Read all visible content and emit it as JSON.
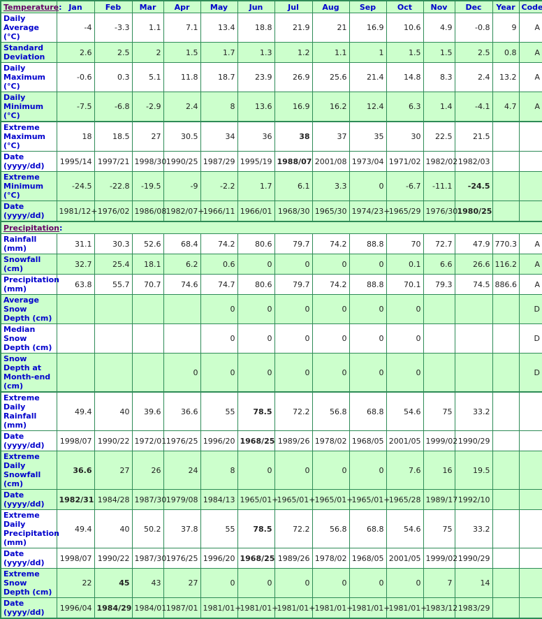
{
  "header": {
    "section_temperature": "Temperature",
    "colon": ":",
    "months": [
      "Jan",
      "Feb",
      "Mar",
      "Apr",
      "May",
      "Jun",
      "Jul",
      "Aug",
      "Sep",
      "Oct",
      "Nov",
      "Dec"
    ],
    "year": "Year",
    "code": "Code"
  },
  "temperature": {
    "daily_average": {
      "label": "Daily Average (°C)",
      "values": [
        "-4",
        "-3.3",
        "1.1",
        "7.1",
        "13.4",
        "18.8",
        "21.9",
        "21",
        "16.9",
        "10.6",
        "4.9",
        "-0.8"
      ],
      "year": "9",
      "code": "A"
    },
    "std_dev": {
      "label": "Standard Deviation",
      "values": [
        "2.6",
        "2.5",
        "2",
        "1.5",
        "1.7",
        "1.3",
        "1.2",
        "1.1",
        "1",
        "1.5",
        "1.5",
        "2.5"
      ],
      "year": "0.8",
      "code": "A"
    },
    "daily_max": {
      "label": "Daily Maximum (°C)",
      "values": [
        "-0.6",
        "0.3",
        "5.1",
        "11.8",
        "18.7",
        "23.9",
        "26.9",
        "25.6",
        "21.4",
        "14.8",
        "8.3",
        "2.4"
      ],
      "year": "13.2",
      "code": "A"
    },
    "daily_min": {
      "label": "Daily Minimum (°C)",
      "values": [
        "-7.5",
        "-6.8",
        "-2.9",
        "2.4",
        "8",
        "13.6",
        "16.9",
        "16.2",
        "12.4",
        "6.3",
        "1.4",
        "-4.1"
      ],
      "year": "4.7",
      "code": "A"
    },
    "extreme_max": {
      "label": "Extreme Maximum (°C)",
      "values": [
        "18",
        "18.5",
        "27",
        "30.5",
        "34",
        "36",
        "38",
        "37",
        "35",
        "30",
        "22.5",
        "21.5"
      ],
      "year": "",
      "code": ""
    },
    "extreme_max_date": {
      "label": "Date (yyyy/dd)",
      "values": [
        "1995/14",
        "1997/21",
        "1998/30",
        "1990/25",
        "1987/29",
        "1995/19",
        "1988/07",
        "2001/08",
        "1973/04",
        "1971/02",
        "1982/02",
        "1982/03"
      ],
      "year": "",
      "code": ""
    },
    "extreme_min": {
      "label": "Extreme Minimum (°C)",
      "values": [
        "-24.5",
        "-22.8",
        "-19.5",
        "-9",
        "-2.2",
        "1.7",
        "6.1",
        "3.3",
        "0",
        "-6.7",
        "-11.1",
        "-24.5"
      ],
      "year": "",
      "code": ""
    },
    "extreme_min_date": {
      "label": "Date (yyyy/dd)",
      "values": [
        "1981/12+",
        "1976/02",
        "1986/08",
        "1982/07+",
        "1966/11",
        "1966/01",
        "1968/30",
        "1965/30",
        "1974/23+",
        "1965/29",
        "1976/30",
        "1980/25"
      ],
      "year": "",
      "code": ""
    }
  },
  "precipitation": {
    "section_label": "Precipitation",
    "rainfall": {
      "label": "Rainfall (mm)",
      "values": [
        "31.1",
        "30.3",
        "52.6",
        "68.4",
        "74.2",
        "80.6",
        "79.7",
        "74.2",
        "88.8",
        "70",
        "72.7",
        "47.9"
      ],
      "year": "770.3",
      "code": "A"
    },
    "snowfall": {
      "label": "Snowfall (cm)",
      "values": [
        "32.7",
        "25.4",
        "18.1",
        "6.2",
        "0.6",
        "0",
        "0",
        "0",
        "0",
        "0.1",
        "6.6",
        "26.6"
      ],
      "year": "116.2",
      "code": "A"
    },
    "precip": {
      "label": "Precipitation (mm)",
      "values": [
        "63.8",
        "55.7",
        "70.7",
        "74.6",
        "74.7",
        "80.6",
        "79.7",
        "74.2",
        "88.8",
        "70.1",
        "79.3",
        "74.5"
      ],
      "year": "886.6",
      "code": "A"
    },
    "avg_snow_depth": {
      "label": "Average Snow Depth (cm)",
      "values": [
        "",
        "",
        "",
        "",
        "0",
        "0",
        "0",
        "0",
        "0",
        "0",
        "",
        ""
      ],
      "year": "",
      "code": "D"
    },
    "median_snow_depth": {
      "label": "Median Snow Depth (cm)",
      "values": [
        "",
        "",
        "",
        "",
        "0",
        "0",
        "0",
        "0",
        "0",
        "0",
        "",
        ""
      ],
      "year": "",
      "code": "D"
    },
    "snow_depth_month_end": {
      "label": "Snow Depth at Month-end (cm)",
      "values": [
        "",
        "",
        "",
        "0",
        "0",
        "0",
        "0",
        "0",
        "0",
        "0",
        "",
        ""
      ],
      "year": "",
      "code": "D"
    },
    "ext_daily_rain": {
      "label": "Extreme Daily Rainfall (mm)",
      "values": [
        "49.4",
        "40",
        "39.6",
        "36.6",
        "55",
        "78.5",
        "72.2",
        "56.8",
        "68.8",
        "54.6",
        "75",
        "33.2"
      ],
      "year": "",
      "code": ""
    },
    "ext_daily_rain_date": {
      "label": "Date (yyyy/dd)",
      "values": [
        "1998/07",
        "1990/22",
        "1972/01",
        "1976/25",
        "1996/20",
        "1968/25",
        "1989/26",
        "1978/02",
        "1968/05",
        "2001/05",
        "1999/02",
        "1990/29"
      ],
      "year": "",
      "code": ""
    },
    "ext_daily_snow": {
      "label": "Extreme Daily Snowfall (cm)",
      "values": [
        "36.6",
        "27",
        "26",
        "24",
        "8",
        "0",
        "0",
        "0",
        "0",
        "7.6",
        "16",
        "19.5"
      ],
      "year": "",
      "code": ""
    },
    "ext_daily_snow_date": {
      "label": "Date (yyyy/dd)",
      "values": [
        "1982/31",
        "1984/28",
        "1987/30",
        "1979/08",
        "1984/13",
        "1965/01+",
        "1965/01+",
        "1965/01+",
        "1965/01+",
        "1965/28",
        "1989/17",
        "1992/10"
      ],
      "year": "",
      "code": ""
    },
    "ext_daily_precip": {
      "label": "Extreme Daily Precipitation (mm)",
      "values": [
        "49.4",
        "40",
        "50.2",
        "37.8",
        "55",
        "78.5",
        "72.2",
        "56.8",
        "68.8",
        "54.6",
        "75",
        "33.2"
      ],
      "year": "",
      "code": ""
    },
    "ext_daily_precip_date": {
      "label": "Date (yyyy/dd)",
      "values": [
        "1998/07",
        "1990/22",
        "1987/30",
        "1976/25",
        "1996/20",
        "1968/25",
        "1989/26",
        "1978/02",
        "1968/05",
        "2001/05",
        "1999/02",
        "1990/29"
      ],
      "year": "",
      "code": ""
    },
    "ext_snow_depth": {
      "label": "Extreme Snow Depth (cm)",
      "values": [
        "22",
        "45",
        "43",
        "27",
        "0",
        "0",
        "0",
        "0",
        "0",
        "0",
        "7",
        "14"
      ],
      "year": "",
      "code": ""
    },
    "ext_snow_depth_date": {
      "label": "Date (yyyy/dd)",
      "values": [
        "1996/04",
        "1984/29",
        "1984/01",
        "1987/01",
        "1981/01+",
        "1981/01+",
        "1981/01+",
        "1981/01+",
        "1981/01+",
        "1981/01+",
        "1983/12",
        "1983/29"
      ],
      "year": "",
      "code": ""
    }
  },
  "bold_cells": {
    "temperature.extreme_max": [
      6
    ],
    "temperature.extreme_max_date": [
      6
    ],
    "temperature.extreme_min": [
      11
    ],
    "temperature.extreme_min_date": [
      11
    ],
    "precipitation.ext_daily_rain": [
      5
    ],
    "precipitation.ext_daily_rain_date": [
      5
    ],
    "precipitation.ext_daily_snow": [
      0
    ],
    "precipitation.ext_daily_snow_date": [
      0
    ],
    "precipitation.ext_daily_precip": [
      5
    ],
    "precipitation.ext_daily_precip_date": [
      5
    ],
    "precipitation.ext_snow_depth": [
      1
    ],
    "precipitation.ext_snow_depth_date": [
      1
    ]
  }
}
